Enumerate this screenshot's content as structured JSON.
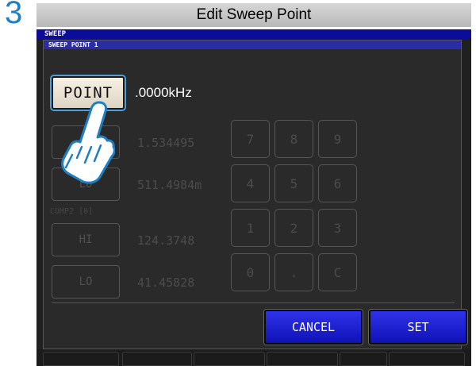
{
  "step_number": "3",
  "window_title": "Edit Sweep Point",
  "mode_header": "SWEEP",
  "dialog_header": "SWEEP POINT 1",
  "point_button_label": "POINT",
  "frequency_value": ".0000kHz",
  "comp1": {
    "hi_value": "1.534495",
    "lo_label": "LO",
    "lo_value": "511.4984m"
  },
  "comp2": {
    "label": "COMP2 [θ]",
    "hi_label": "HI",
    "hi_value": "124.3748",
    "lo_label": "LO",
    "lo_value": "41.45828"
  },
  "keypad": [
    "7",
    "8",
    "9",
    "4",
    "5",
    "6",
    "1",
    "2",
    "3",
    "0",
    ".",
    "C"
  ],
  "cancel_label": "CANCEL",
  "set_label": "SET",
  "colors": {
    "accent_blue": "#1f7fc4",
    "button_blue": "#2f32e8",
    "header_blue": "#0c0c9a"
  }
}
